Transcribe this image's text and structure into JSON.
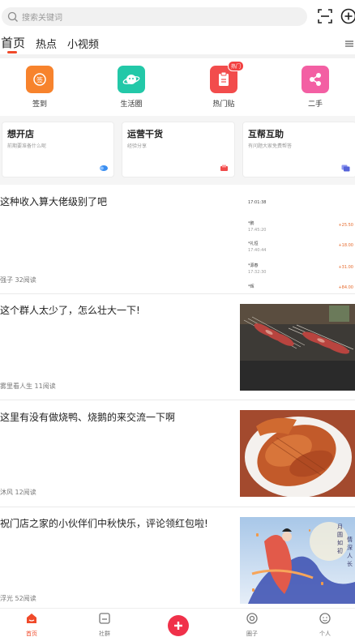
{
  "search": {
    "placeholder": "搜索关键词"
  },
  "tabs": [
    {
      "label": "首页",
      "active": true
    },
    {
      "label": "热点"
    },
    {
      "label": "小视频"
    }
  ],
  "categories": [
    {
      "label": "签到",
      "icon": "checkin-icon",
      "color": "#f7832d"
    },
    {
      "label": "生活圈",
      "icon": "planet-icon",
      "color": "#23c8a8"
    },
    {
      "label": "热门贴",
      "icon": "hot-post-icon",
      "color": "#f24c4c",
      "badge": "热门"
    },
    {
      "label": "二手",
      "icon": "share-nodes-icon",
      "color": "#f35fa3"
    }
  ],
  "cards": [
    {
      "title": "想开店",
      "subtitle": "前期要准备什么呢",
      "icon": "bubble-icon",
      "icon_color": "#3a8ef0"
    },
    {
      "title": "运营干货",
      "subtitle": "经验分享",
      "icon": "card-icon",
      "icon_color": "#f04a4a"
    },
    {
      "title": "互帮互助",
      "subtitle": "有问题大家免费帮答",
      "icon": "chat-icon",
      "icon_color": "#5563d9"
    }
  ],
  "posts": [
    {
      "title": "这种收入算大佬级别了吧",
      "meta": "强子 32阅读",
      "ledger": [
        {
          "time": "17:01:38",
          "name": "",
          "amount": ""
        },
        {
          "name": "*鹏",
          "time": "17:45:20",
          "amount": "+25.50"
        },
        {
          "name": "*礼恒",
          "time": "17:40:44",
          "amount": "+18.00"
        },
        {
          "name": "*源春",
          "time": "17:32:30",
          "amount": "+31.00"
        },
        {
          "name": "*辉",
          "time": "",
          "amount": "+84.00"
        }
      ]
    },
    {
      "title": "这个群人太少了，怎么壮大一下!",
      "meta": "雾里看人生 11阅读",
      "thumb": "bbq-skewers"
    },
    {
      "title": "这里有没有做烧鸭、烧鹅的来交流一下啊",
      "meta": "沐风 12阅读",
      "thumb": "roast-duck"
    },
    {
      "title": "祝门店之家的小伙伴们中秋快乐，评论领红包啦!",
      "meta": "浮光 52阅读",
      "thumb": "mid-autumn"
    }
  ],
  "bottom_nav": [
    {
      "label": "首页",
      "icon": "home-icon",
      "active": true
    },
    {
      "label": "社群",
      "icon": "community-icon"
    },
    {
      "label": "",
      "icon": "add-icon"
    },
    {
      "label": "圈子",
      "icon": "circle-icon"
    },
    {
      "label": "个人",
      "icon": "profile-icon"
    }
  ],
  "colors": {
    "accent": "#f04a2a",
    "fab": "#f0314a"
  }
}
